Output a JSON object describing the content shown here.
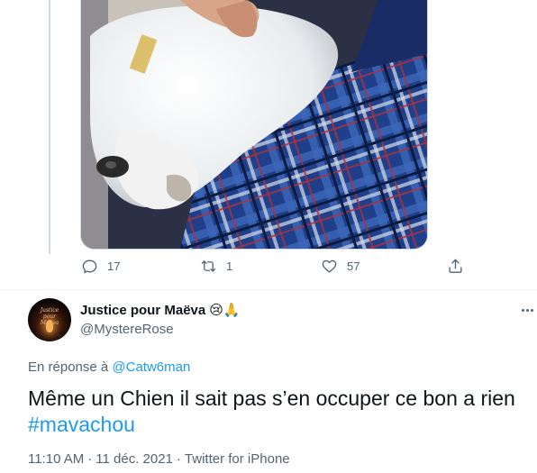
{
  "prev_tweet": {
    "image_alt": "Photo of a white dog lying on a blue tartan blanket",
    "actions": {
      "reply_count": "17",
      "retweet_count": "1",
      "like_count": "57"
    }
  },
  "reply": {
    "display_name": "Justice pour Maëva",
    "name_emojis": "😢🙏",
    "handle": "@MystereRose",
    "avatar_text": "Justice pour Maëva",
    "replying_to_prefix": "En réponse à",
    "replying_to_handle": "@Catw6man",
    "text": "Même un Chien il sait pas s’en occuper ce bon a rien",
    "hashtag": "#mavachou",
    "time": "11:10 AM",
    "date": "11 déc. 2021",
    "sep": "·",
    "source": "Twitter for iPhone"
  },
  "colors": {
    "accent": "#1d9bf0",
    "secondary_text": "#536471",
    "primary_text": "#0f1419",
    "border": "#cfd9de"
  }
}
